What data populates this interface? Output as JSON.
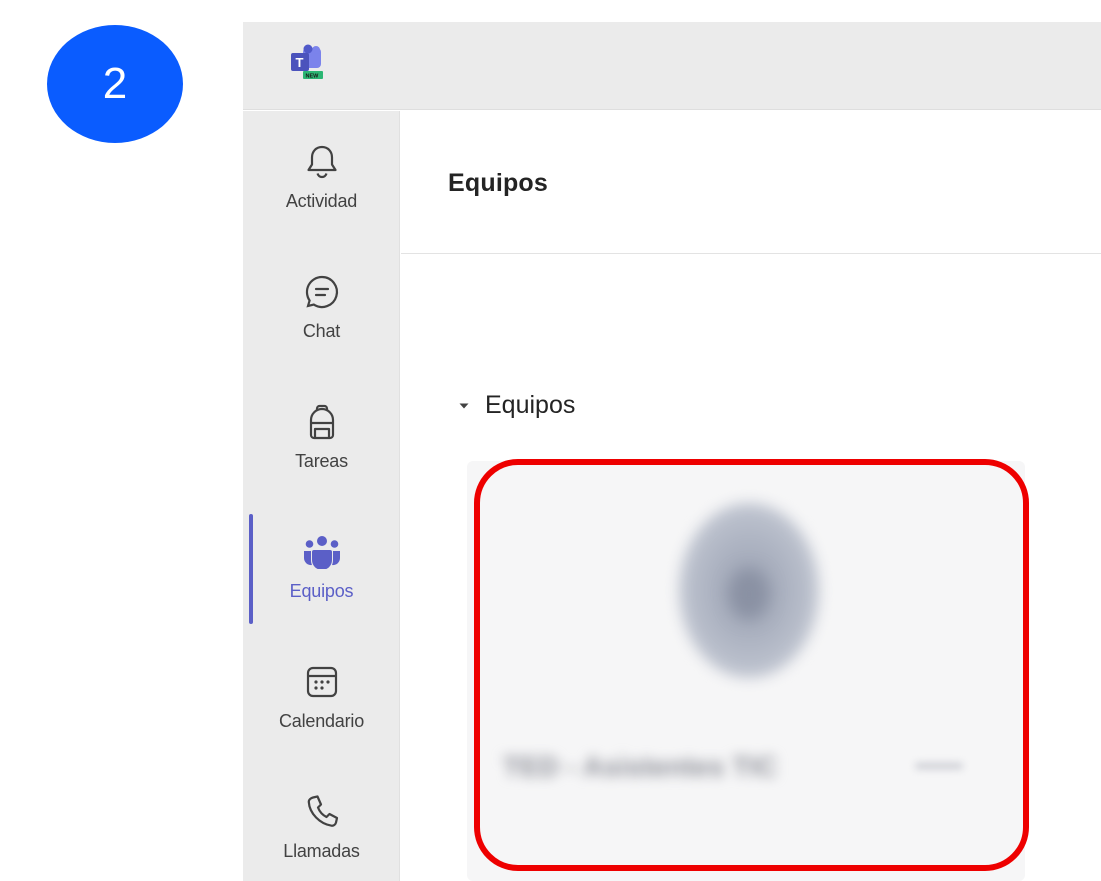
{
  "step": {
    "number": "2",
    "color": "#0a5cff"
  },
  "app": {
    "logo_icon": "teams-logo-icon",
    "logo_badge": "NEW",
    "accent_color": "#5b5fc7"
  },
  "rail": {
    "items": [
      {
        "label": "Actividad",
        "icon": "bell-icon"
      },
      {
        "label": "Chat",
        "icon": "chat-bubble-icon"
      },
      {
        "label": "Tareas",
        "icon": "backpack-icon"
      },
      {
        "label": "Equipos",
        "icon": "teams-people-icon",
        "active": true
      },
      {
        "label": "Calendario",
        "icon": "calendar-icon"
      },
      {
        "label": "Llamadas",
        "icon": "phone-icon"
      }
    ]
  },
  "main": {
    "title": "Equipos",
    "section_label": "Equipos",
    "team_card": {
      "name_blurred": "TED - Asistentes TIC",
      "highlight_color": "#ee0000"
    }
  }
}
